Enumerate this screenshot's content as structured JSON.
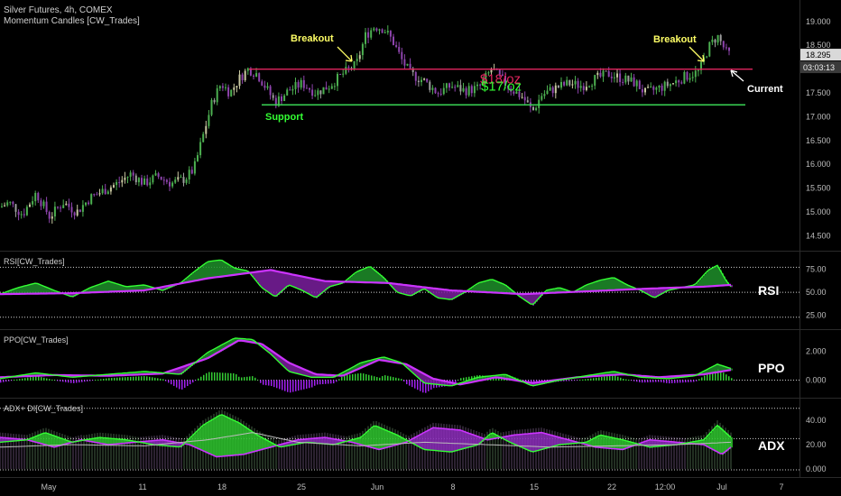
{
  "header": {
    "title": "Silver Futures, 4h, COMEX",
    "indicator": "Momentum Candles [CW_Trades]"
  },
  "colors": {
    "background": "#000000",
    "bull": "#4caf50",
    "bear": "#8e44ad",
    "neutral": "#9e9e9e",
    "resistance": "#e0245e",
    "support": "#39d353",
    "rsi": "#a020f0",
    "ppo": "#33ff33",
    "adx_di": "#33ff33"
  },
  "price_axis": {
    "ticks": [
      "19.000",
      "18.500",
      "18.000",
      "17.500",
      "17.000",
      "16.500",
      "16.000",
      "15.500",
      "15.000",
      "14.500"
    ],
    "last_price": "18.295",
    "countdown": "03:03:13"
  },
  "annotations": {
    "breakout_left": "Breakout",
    "breakout_right": "Breakout",
    "support": "Support",
    "current": "Current",
    "level_18": "$18/oz",
    "level_17": "$17/oz"
  },
  "panels": {
    "rsi": {
      "title": "RSI[CW_Trades]",
      "tag": "RSI",
      "ticks": [
        "75.00",
        "50.00",
        "25.00"
      ]
    },
    "ppo": {
      "title": "PPO[CW_Trades]",
      "tag": "PPO",
      "ticks": [
        "2.000",
        "0.000"
      ]
    },
    "adx": {
      "title": "ADX+ DI[CW_Trades]",
      "tag": "ADX",
      "ticks": [
        "40.00",
        "20.00",
        "0.000"
      ]
    }
  },
  "x_axis": {
    "ticks": [
      "May",
      "11",
      "18",
      "25",
      "Jun",
      "8",
      "15",
      "22",
      "12:00",
      "Jul",
      "7"
    ]
  },
  "chart_data": {
    "type": "candlestick",
    "title": "Silver Futures, 4h, COMEX",
    "y_range": [
      14.3,
      19.3
    ],
    "levels": {
      "resistance": 18.0,
      "support": 17.25
    },
    "price_path": [
      [
        0,
        15.1
      ],
      [
        10,
        15.2
      ],
      [
        25,
        14.95
      ],
      [
        40,
        15.4
      ],
      [
        55,
        14.9
      ],
      [
        70,
        15.2
      ],
      [
        85,
        15.0
      ],
      [
        100,
        15.3
      ],
      [
        115,
        15.45
      ],
      [
        130,
        15.6
      ],
      [
        145,
        15.8
      ],
      [
        160,
        15.6
      ],
      [
        175,
        15.75
      ],
      [
        190,
        15.6
      ],
      [
        205,
        15.7
      ],
      [
        215,
        15.9
      ],
      [
        225,
        16.6
      ],
      [
        235,
        17.3
      ],
      [
        245,
        17.7
      ],
      [
        255,
        17.5
      ],
      [
        265,
        17.8
      ],
      [
        275,
        18.0
      ],
      [
        285,
        17.9
      ],
      [
        295,
        17.6
      ],
      [
        305,
        17.3
      ],
      [
        320,
        17.55
      ],
      [
        335,
        17.7
      ],
      [
        350,
        17.5
      ],
      [
        365,
        17.65
      ],
      [
        380,
        17.9
      ],
      [
        395,
        18.1
      ],
      [
        405,
        18.7
      ],
      [
        415,
        18.9
      ],
      [
        425,
        18.85
      ],
      [
        435,
        18.6
      ],
      [
        445,
        18.2
      ],
      [
        455,
        17.9
      ],
      [
        470,
        17.75
      ],
      [
        485,
        17.5
      ],
      [
        500,
        17.65
      ],
      [
        515,
        17.55
      ],
      [
        530,
        17.6
      ],
      [
        545,
        18.0
      ],
      [
        555,
        17.8
      ],
      [
        565,
        17.6
      ],
      [
        580,
        17.4
      ],
      [
        590,
        17.1
      ],
      [
        600,
        17.45
      ],
      [
        615,
        17.6
      ],
      [
        630,
        17.7
      ],
      [
        645,
        17.65
      ],
      [
        660,
        17.8
      ],
      [
        675,
        17.9
      ],
      [
        690,
        17.8
      ],
      [
        705,
        17.7
      ],
      [
        715,
        17.5
      ],
      [
        730,
        17.6
      ],
      [
        745,
        17.7
      ],
      [
        760,
        17.85
      ],
      [
        775,
        17.95
      ],
      [
        785,
        18.45
      ],
      [
        795,
        18.7
      ],
      [
        805,
        18.35
      ],
      [
        810,
        18.3
      ]
    ],
    "rsi_range": [
      15,
      90
    ],
    "rsi_path": [
      [
        0,
        48
      ],
      [
        20,
        55
      ],
      [
        40,
        60
      ],
      [
        60,
        52
      ],
      [
        80,
        45
      ],
      [
        100,
        55
      ],
      [
        120,
        62
      ],
      [
        140,
        56
      ],
      [
        160,
        58
      ],
      [
        180,
        52
      ],
      [
        200,
        60
      ],
      [
        215,
        72
      ],
      [
        230,
        83
      ],
      [
        245,
        85
      ],
      [
        260,
        76
      ],
      [
        275,
        73
      ],
      [
        290,
        55
      ],
      [
        305,
        45
      ],
      [
        320,
        58
      ],
      [
        335,
        52
      ],
      [
        350,
        44
      ],
      [
        365,
        56
      ],
      [
        380,
        60
      ],
      [
        395,
        72
      ],
      [
        410,
        78
      ],
      [
        425,
        66
      ],
      [
        440,
        50
      ],
      [
        455,
        46
      ],
      [
        470,
        54
      ],
      [
        485,
        44
      ],
      [
        500,
        42
      ],
      [
        515,
        50
      ],
      [
        530,
        60
      ],
      [
        545,
        64
      ],
      [
        560,
        58
      ],
      [
        575,
        46
      ],
      [
        590,
        36
      ],
      [
        605,
        52
      ],
      [
        620,
        55
      ],
      [
        635,
        50
      ],
      [
        650,
        58
      ],
      [
        665,
        63
      ],
      [
        680,
        66
      ],
      [
        695,
        58
      ],
      [
        710,
        52
      ],
      [
        725,
        44
      ],
      [
        740,
        52
      ],
      [
        755,
        55
      ],
      [
        770,
        58
      ],
      [
        785,
        74
      ],
      [
        795,
        79
      ],
      [
        805,
        62
      ],
      [
        810,
        56
      ]
    ],
    "rsi_avg_path": [
      [
        0,
        48
      ],
      [
        80,
        49
      ],
      [
        160,
        52
      ],
      [
        230,
        65
      ],
      [
        300,
        74
      ],
      [
        360,
        62
      ],
      [
        430,
        60
      ],
      [
        500,
        52
      ],
      [
        580,
        48
      ],
      [
        650,
        51
      ],
      [
        720,
        54
      ],
      [
        780,
        56
      ],
      [
        810,
        58
      ]
    ],
    "ppo_range": [
      -0.9,
      3.2
    ],
    "ppo_path": [
      [
        0,
        0.1
      ],
      [
        40,
        0.5
      ],
      [
        80,
        0.2
      ],
      [
        120,
        0.4
      ],
      [
        160,
        0.6
      ],
      [
        200,
        0.4
      ],
      [
        230,
        1.9
      ],
      [
        260,
        2.9
      ],
      [
        280,
        2.8
      ],
      [
        300,
        1.8
      ],
      [
        320,
        0.6
      ],
      [
        345,
        0.2
      ],
      [
        370,
        0.2
      ],
      [
        400,
        1.2
      ],
      [
        425,
        1.6
      ],
      [
        445,
        1.2
      ],
      [
        470,
        -0.2
      ],
      [
        500,
        -0.4
      ],
      [
        530,
        0.2
      ],
      [
        560,
        0.4
      ],
      [
        590,
        -0.4
      ],
      [
        620,
        0.0
      ],
      [
        650,
        0.3
      ],
      [
        680,
        0.6
      ],
      [
        710,
        0.2
      ],
      [
        740,
        0.1
      ],
      [
        770,
        0.3
      ],
      [
        795,
        1.1
      ],
      [
        810,
        0.8
      ]
    ],
    "ppo_signal_path": [
      [
        0,
        0.2
      ],
      [
        60,
        0.35
      ],
      [
        120,
        0.3
      ],
      [
        180,
        0.45
      ],
      [
        230,
        1.5
      ],
      [
        265,
        2.75
      ],
      [
        290,
        2.5
      ],
      [
        320,
        1.2
      ],
      [
        350,
        0.4
      ],
      [
        380,
        0.3
      ],
      [
        420,
        1.4
      ],
      [
        450,
        1.1
      ],
      [
        480,
        0.1
      ],
      [
        510,
        -0.3
      ],
      [
        550,
        0.2
      ],
      [
        590,
        -0.2
      ],
      [
        640,
        0.2
      ],
      [
        690,
        0.4
      ],
      [
        730,
        0.2
      ],
      [
        780,
        0.4
      ],
      [
        810,
        0.7
      ]
    ],
    "adx_range": [
      -3,
      55
    ],
    "adx_plus_path": [
      [
        0,
        22
      ],
      [
        30,
        24
      ],
      [
        50,
        30
      ],
      [
        80,
        22
      ],
      [
        110,
        26
      ],
      [
        140,
        24
      ],
      [
        170,
        20
      ],
      [
        200,
        18
      ],
      [
        225,
        36
      ],
      [
        245,
        45
      ],
      [
        265,
        38
      ],
      [
        285,
        28
      ],
      [
        310,
        18
      ],
      [
        340,
        22
      ],
      [
        370,
        20
      ],
      [
        400,
        26
      ],
      [
        415,
        36
      ],
      [
        440,
        28
      ],
      [
        470,
        16
      ],
      [
        500,
        14
      ],
      [
        530,
        20
      ],
      [
        545,
        30
      ],
      [
        565,
        22
      ],
      [
        590,
        14
      ],
      [
        620,
        20
      ],
      [
        650,
        22
      ],
      [
        665,
        28
      ],
      [
        690,
        24
      ],
      [
        720,
        18
      ],
      [
        750,
        20
      ],
      [
        780,
        24
      ],
      [
        795,
        36
      ],
      [
        810,
        26
      ]
    ],
    "adx_minus_path": [
      [
        0,
        26
      ],
      [
        30,
        24
      ],
      [
        60,
        18
      ],
      [
        90,
        24
      ],
      [
        120,
        20
      ],
      [
        150,
        22
      ],
      [
        180,
        24
      ],
      [
        210,
        20
      ],
      [
        240,
        10
      ],
      [
        270,
        12
      ],
      [
        300,
        18
      ],
      [
        330,
        24
      ],
      [
        360,
        26
      ],
      [
        390,
        22
      ],
      [
        420,
        16
      ],
      [
        450,
        22
      ],
      [
        480,
        34
      ],
      [
        510,
        32
      ],
      [
        540,
        24
      ],
      [
        570,
        28
      ],
      [
        600,
        30
      ],
      [
        630,
        24
      ],
      [
        660,
        18
      ],
      [
        690,
        16
      ],
      [
        720,
        24
      ],
      [
        750,
        22
      ],
      [
        780,
        20
      ],
      [
        800,
        12
      ],
      [
        810,
        18
      ]
    ],
    "adx_line_path": [
      [
        0,
        18
      ],
      [
        80,
        20
      ],
      [
        160,
        19
      ],
      [
        230,
        24
      ],
      [
        280,
        30
      ],
      [
        330,
        22
      ],
      [
        400,
        19
      ],
      [
        470,
        22
      ],
      [
        540,
        20
      ],
      [
        610,
        18
      ],
      [
        680,
        19
      ],
      [
        750,
        20
      ],
      [
        810,
        22
      ]
    ]
  }
}
